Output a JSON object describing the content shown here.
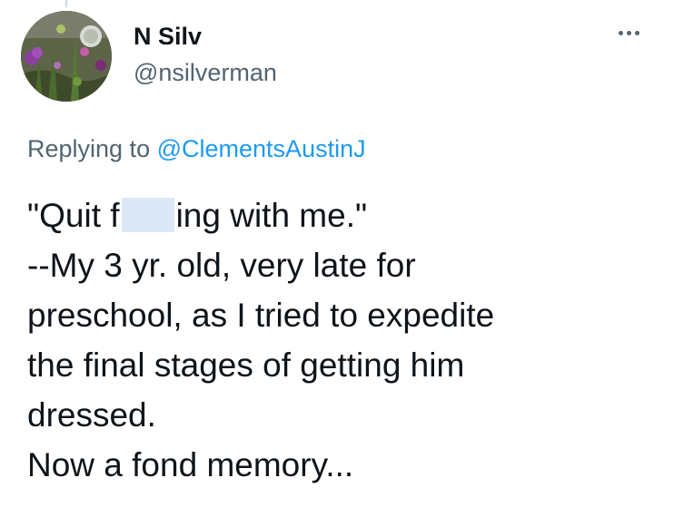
{
  "tweet": {
    "author": {
      "display_name": "N Silv",
      "handle": "@nsilverman",
      "avatar_icon": "garden-flowers-avatar"
    },
    "more_icon": "more-horizontal-icon",
    "reply_context": {
      "prefix": "Replying to",
      "mention": "@ClementsAustinJ"
    },
    "body": {
      "line1_before_redaction": "\"Quit f",
      "line1_after_redaction": "ing with me.\"",
      "lines": [
        "--My 3 yr. old, very late for",
        "preschool, as I tried to expedite",
        "the final stages of getting him",
        "dressed.",
        "Now a fond memory..."
      ]
    }
  },
  "colors": {
    "link": "#1d9bf0",
    "secondary_text": "#536471",
    "primary_text": "#0f1419",
    "redaction": "#dde8f6"
  }
}
